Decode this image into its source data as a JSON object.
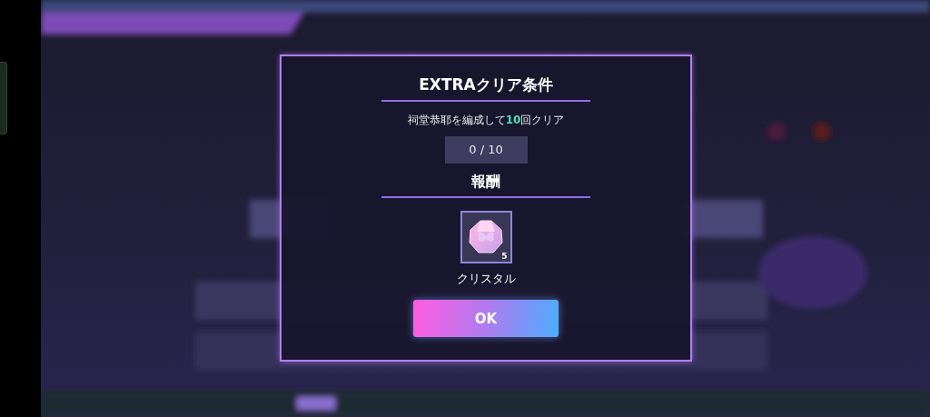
{
  "dialog": {
    "title": "EXTRAクリア条件",
    "condition": [
      {
        "text": "祠堂恭耶を編成して",
        "highlight": false
      },
      {
        "text": "10",
        "highlight": true
      },
      {
        "text": "回クリア",
        "highlight": false
      }
    ],
    "progress": "0 / 10",
    "reward_heading": "報酬",
    "reward": {
      "name": "クリスタル",
      "count": "5"
    },
    "button": "OK"
  }
}
